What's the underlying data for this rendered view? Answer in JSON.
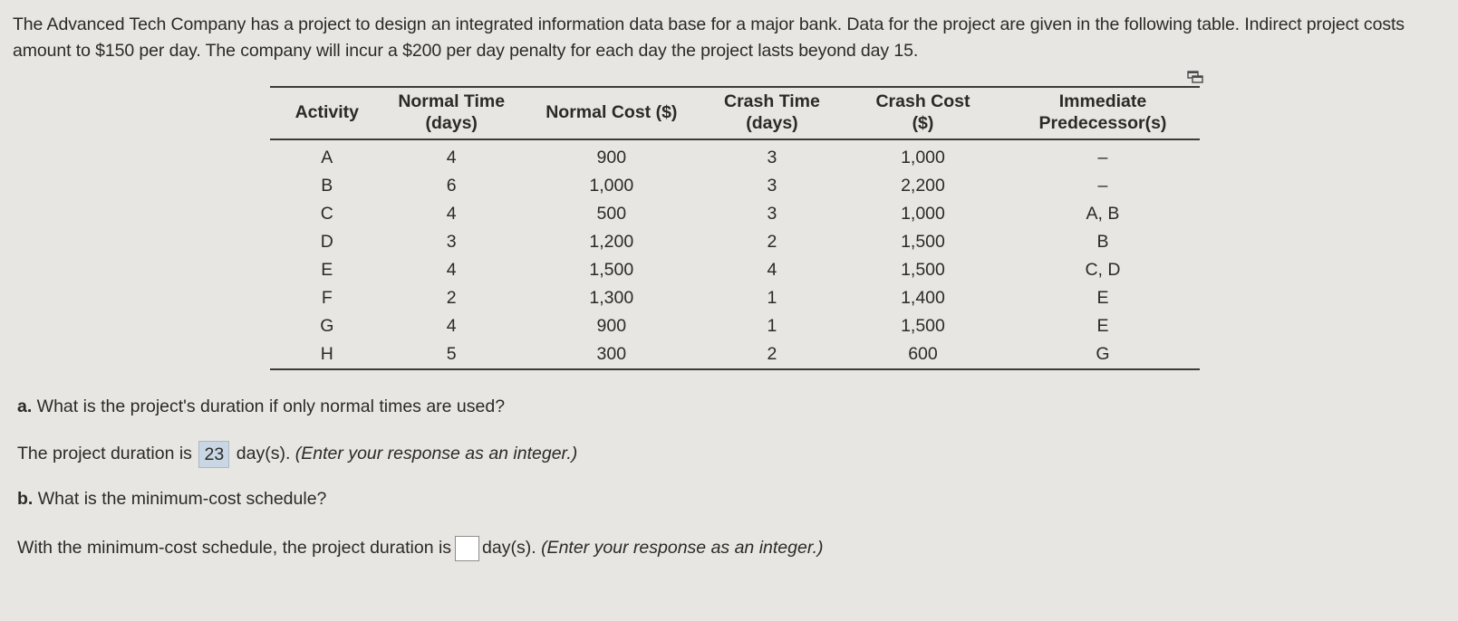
{
  "problem": {
    "intro_text": "The Advanced Tech Company has a project to design an integrated information data base for a major bank. Data for the project are given in the following table. Indirect project costs amount to $150 per day. The company will incur a $200 per day penalty for each day the project lasts beyond day 15."
  },
  "table": {
    "popout_icon": "popout-window-icon",
    "headers": {
      "activity": "Activity",
      "normal_time": [
        "Normal Time",
        "(days)"
      ],
      "normal_cost": "Normal Cost ($)",
      "crash_time": [
        "Crash Time",
        "(days)"
      ],
      "crash_cost": [
        "Crash Cost",
        "($)"
      ],
      "predecessors": [
        "Immediate",
        "Predecessor(s)"
      ]
    },
    "rows": [
      {
        "activity": "A",
        "normal_time": "4",
        "normal_cost": "900",
        "crash_time": "3",
        "crash_cost": "1,000",
        "predecessors": "–"
      },
      {
        "activity": "B",
        "normal_time": "6",
        "normal_cost": "1,000",
        "crash_time": "3",
        "crash_cost": "2,200",
        "predecessors": "–"
      },
      {
        "activity": "C",
        "normal_time": "4",
        "normal_cost": "500",
        "crash_time": "3",
        "crash_cost": "1,000",
        "predecessors": "A, B"
      },
      {
        "activity": "D",
        "normal_time": "3",
        "normal_cost": "1,200",
        "crash_time": "2",
        "crash_cost": "1,500",
        "predecessors": "B"
      },
      {
        "activity": "E",
        "normal_time": "4",
        "normal_cost": "1,500",
        "crash_time": "4",
        "crash_cost": "1,500",
        "predecessors": "C, D"
      },
      {
        "activity": "F",
        "normal_time": "2",
        "normal_cost": "1,300",
        "crash_time": "1",
        "crash_cost": "1,400",
        "predecessors": "E"
      },
      {
        "activity": "G",
        "normal_time": "4",
        "normal_cost": "900",
        "crash_time": "1",
        "crash_cost": "1,500",
        "predecessors": "E"
      },
      {
        "activity": "H",
        "normal_time": "5",
        "normal_cost": "300",
        "crash_time": "2",
        "crash_cost": "600",
        "predecessors": "G"
      }
    ]
  },
  "part_a": {
    "label": "a.",
    "question": " What is the project's duration if only normal times are used?",
    "answer_prefix": "The project duration is ",
    "answer_value": "23",
    "answer_suffix": " day(s). ",
    "instruction": "(Enter your response as an integer.)"
  },
  "part_b": {
    "label": "b.",
    "question": " What is the minimum-cost schedule?",
    "answer_prefix": "With the minimum-cost schedule, the project duration is",
    "answer_value": "",
    "answer_suffix": "day(s). ",
    "instruction": "(Enter your response as an integer.)"
  }
}
